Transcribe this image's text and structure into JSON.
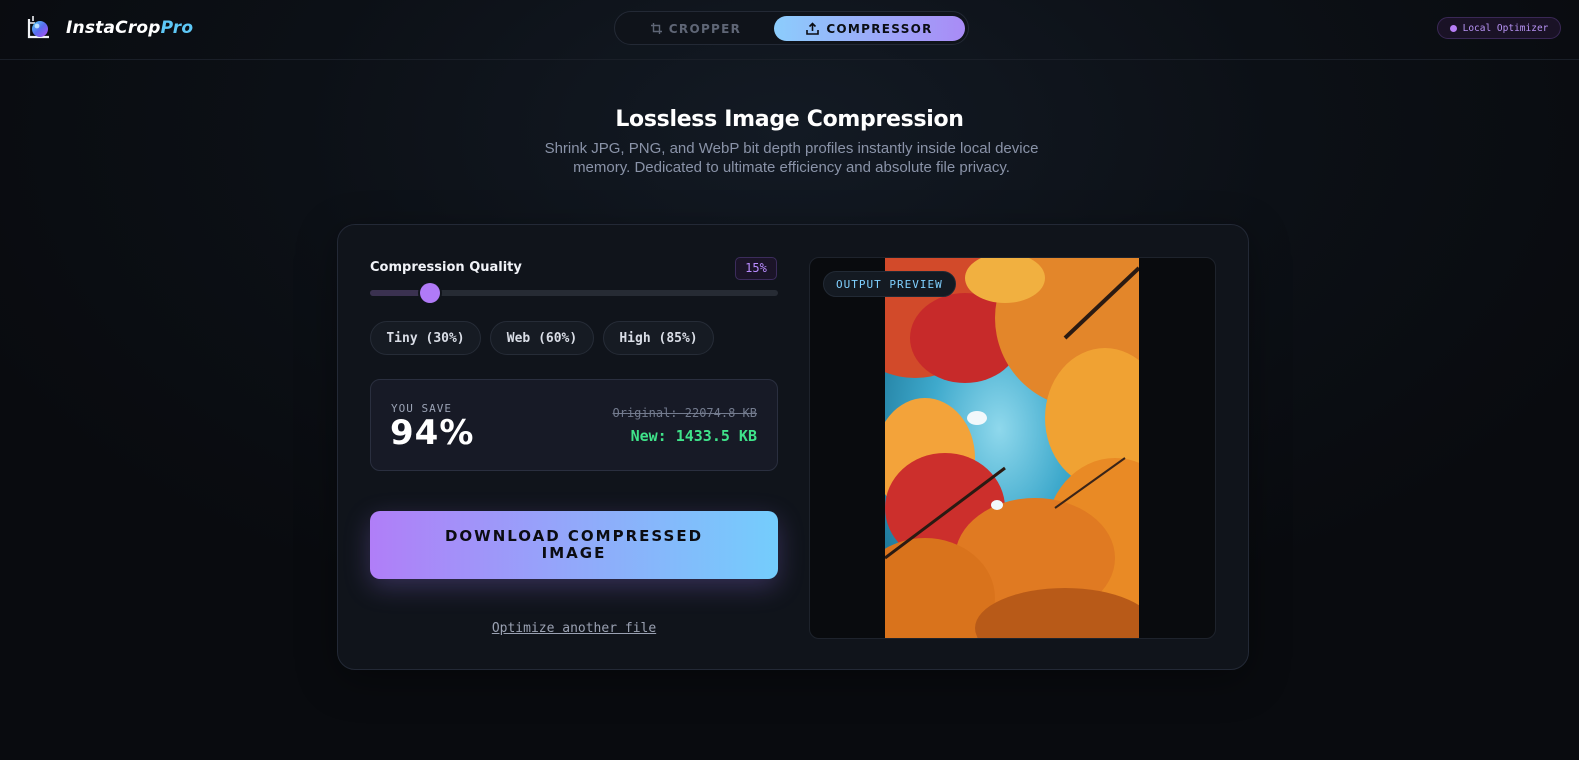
{
  "header": {
    "brand_main": "InstaCrop",
    "brand_accent": "Pro",
    "tabs": [
      {
        "label": "CROPPER",
        "icon": "crop-icon",
        "active": false
      },
      {
        "label": "COMPRESSOR",
        "icon": "upload-icon",
        "active": true
      }
    ],
    "badge": "Local Optimizer"
  },
  "hero": {
    "title": "Lossless Image Compression",
    "subtitle": "Shrink JPG, PNG, and WebP bit depth profiles instantly inside local device memory. Dedicated to ultimate efficiency and absolute file privacy."
  },
  "controls": {
    "quality_label": "Compression Quality",
    "quality_value_text": "15%",
    "quality_value": 0.15,
    "slider_min": 0.03,
    "presets": [
      "Tiny (30%)",
      "Web (60%)",
      "High (85%)"
    ]
  },
  "savings": {
    "label": "YOU SAVE",
    "percent": "94%",
    "original": "Original: 22074.8 KB",
    "new": "New: 1433.5 KB"
  },
  "actions": {
    "download_line1": "DOWNLOAD COMPRESSED",
    "download_line2": "IMAGE",
    "another": "Optimize another file"
  },
  "preview": {
    "tag": "OUTPUT PREVIEW"
  },
  "colors": {
    "accent_purple": "#b07af7",
    "accent_blue": "#74cdfc",
    "success_green": "#3fe38a"
  }
}
